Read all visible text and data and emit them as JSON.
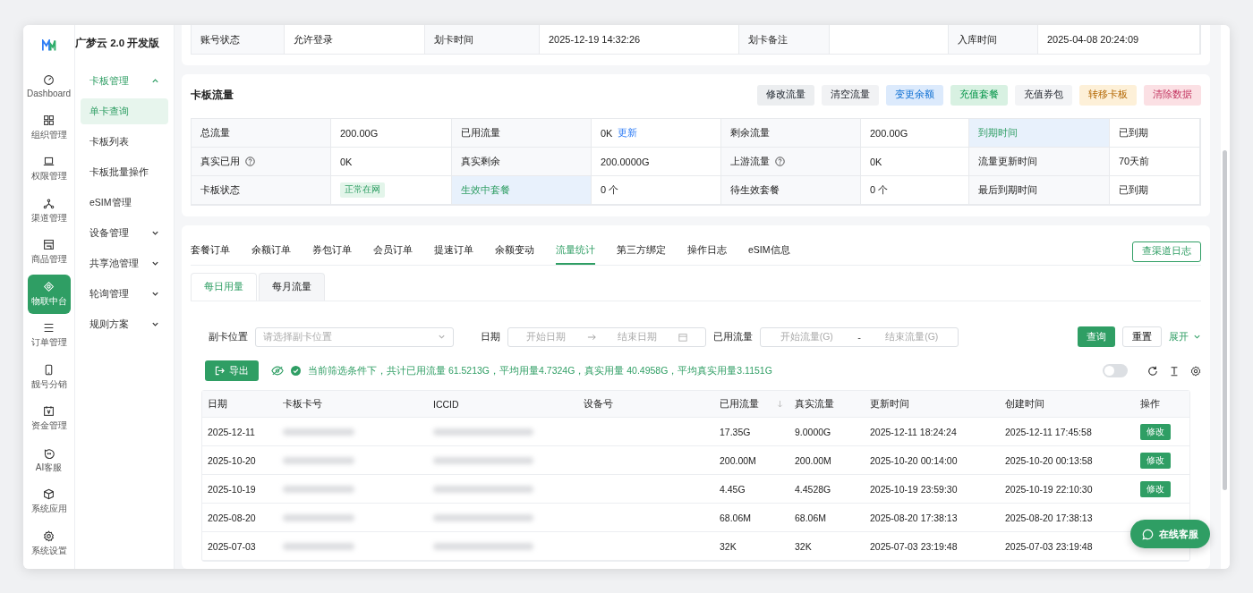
{
  "brand": {
    "title": "广梦云 2.0 开发版"
  },
  "nav_rail": [
    {
      "label": "Dashboard",
      "selected": false
    },
    {
      "label": "组织管理",
      "selected": false
    },
    {
      "label": "权限管理",
      "selected": false
    },
    {
      "label": "渠道管理",
      "selected": false
    },
    {
      "label": "商品管理",
      "selected": false
    },
    {
      "label": "物联中台",
      "selected": true
    },
    {
      "label": "订单管理",
      "selected": false
    },
    {
      "label": "靓号分销",
      "selected": false
    },
    {
      "label": "资金管理",
      "selected": false
    },
    {
      "label": "AI客服",
      "selected": false
    },
    {
      "label": "系统应用",
      "selected": false
    },
    {
      "label": "系统设置",
      "selected": false
    }
  ],
  "submenu": [
    {
      "label": "卡板管理",
      "expanded": true,
      "children": [
        {
          "label": "单卡查询",
          "selected": true
        },
        {
          "label": "卡板列表",
          "selected": false
        },
        {
          "label": "卡板批量操作",
          "selected": false
        },
        {
          "label": "eSIM管理",
          "selected": false
        }
      ]
    },
    {
      "label": "设备管理",
      "expanded": false
    },
    {
      "label": "共享池管理",
      "expanded": false
    },
    {
      "label": "轮询管理",
      "expanded": false
    },
    {
      "label": "规则方案",
      "expanded": false
    }
  ],
  "info_row": [
    {
      "label": "账号状态",
      "value": "允许登录"
    },
    {
      "label": "划卡时间",
      "value": "2025-12-19 14:32:26"
    },
    {
      "label": "划卡备注"
    },
    {
      "label": "入库时间",
      "value": "2025-04-08 20:24:09"
    }
  ],
  "flow_card": {
    "title": "卡板流量",
    "actions": [
      {
        "label": "修改流量",
        "color": "#eceef0"
      },
      {
        "label": "清空流量",
        "color": "#f1f2f4"
      },
      {
        "label": "变更余额",
        "color": "#dceafc"
      },
      {
        "label": "充值套餐",
        "color": "#d8f1e2"
      },
      {
        "label": "充值券包",
        "color": "#f3f4f6"
      },
      {
        "label": "转移卡板",
        "color": "#fdf0d8"
      },
      {
        "label": "清除数据",
        "color": "#fbe0e4"
      }
    ],
    "rows": [
      [
        {
          "text": "总流量",
          "kind": "label"
        },
        {
          "text": "200.00G",
          "kind": "value"
        },
        {
          "text": "已用流量",
          "kind": "label"
        },
        {
          "text": "0K",
          "kind": "value",
          "link": "更新"
        },
        {
          "text": "剩余流量",
          "kind": "label"
        },
        {
          "text": "200.00G",
          "kind": "value"
        },
        {
          "text": "到期时间",
          "kind": "label",
          "highlight": true
        },
        {
          "text": "已到期",
          "kind": "value"
        }
      ],
      [
        {
          "text": "真实已用",
          "kind": "label",
          "help": true
        },
        {
          "text": "0K",
          "kind": "value"
        },
        {
          "text": "真实剩余",
          "kind": "label"
        },
        {
          "text": "200.0000G",
          "kind": "value"
        },
        {
          "text": "上游流量",
          "kind": "label",
          "help": true
        },
        {
          "text": "0K",
          "kind": "value"
        },
        {
          "text": "流量更新时间",
          "kind": "label"
        },
        {
          "text": "70天前",
          "kind": "value"
        }
      ],
      [
        {
          "text": "卡板状态",
          "kind": "label"
        },
        {
          "text": "正常在网",
          "kind": "badge"
        },
        {
          "text": "生效中套餐",
          "kind": "label",
          "highlight": true
        },
        {
          "text": "0 个",
          "kind": "value"
        },
        {
          "text": "待生效套餐",
          "kind": "label"
        },
        {
          "text": "0 个",
          "kind": "value"
        },
        {
          "text": "最后到期时间",
          "kind": "label"
        },
        {
          "text": "已到期",
          "kind": "value"
        }
      ]
    ]
  },
  "tabs": [
    {
      "label": "套餐订单",
      "selected": false
    },
    {
      "label": "余额订单",
      "selected": false
    },
    {
      "label": "券包订单",
      "selected": false
    },
    {
      "label": "会员订单",
      "selected": false
    },
    {
      "label": "提速订单",
      "selected": false
    },
    {
      "label": "余额变动",
      "selected": false
    },
    {
      "label": "流量统计",
      "selected": true
    },
    {
      "label": "第三方绑定",
      "selected": false
    },
    {
      "label": "操作日志",
      "selected": false
    },
    {
      "label": "eSIM信息",
      "selected": false
    }
  ],
  "channel_log_button": "查渠道日志",
  "subtabs": [
    {
      "label": "每日用量",
      "selected": true
    },
    {
      "label": "每月流量",
      "selected": false
    }
  ],
  "filters": {
    "sub_card": {
      "label": "副卡位置",
      "placeholder": "请选择副卡位置"
    },
    "date": {
      "label": "日期",
      "start_placeholder": "开始日期",
      "end_placeholder": "结束日期"
    },
    "usage": {
      "label": "已用流量",
      "start_placeholder": "开始流量(G)",
      "separator": "-",
      "end_placeholder": "结束流量(G)"
    },
    "query": "查询",
    "reset": "重置",
    "expand": "展开"
  },
  "export_button": "导出",
  "summary": "当前筛选条件下，共计已用流量 61.5213G，平均用量4.7324G，真实用量 40.4958G，平均真实用量3.1151G",
  "column_toggle": {
    "on": false
  },
  "table": {
    "columns": [
      {
        "label": "日期",
        "sortable": false
      },
      {
        "label": "卡板卡号",
        "sortable": false
      },
      {
        "label": "ICCID",
        "sortable": false
      },
      {
        "label": "设备号",
        "sortable": false
      },
      {
        "label": "已用流量",
        "sortable": true
      },
      {
        "label": "真实流量",
        "sortable": false
      },
      {
        "label": "更新时间",
        "sortable": false
      },
      {
        "label": "创建时间",
        "sortable": false
      },
      {
        "label": "操作",
        "sortable": false
      }
    ],
    "rows": [
      {
        "date": "2025-12-11",
        "used": "17.35G",
        "real": "9.0000G",
        "updated": "2025-12-11 18:24:24",
        "created": "2025-12-11 17:45:58",
        "action": "修改"
      },
      {
        "date": "2025-10-20",
        "used": "200.00M",
        "real": "200.00M",
        "updated": "2025-10-20 00:14:00",
        "created": "2025-10-20 00:13:58",
        "action": "修改"
      },
      {
        "date": "2025-10-19",
        "used": "4.45G",
        "real": "4.4528G",
        "updated": "2025-10-19 23:59:30",
        "created": "2025-10-19 22:10:30",
        "action": "修改"
      },
      {
        "date": "2025-08-20",
        "used": "68.06M",
        "real": "68.06M",
        "updated": "2025-08-20 17:38:13",
        "created": "2025-08-20 17:38:13"
      },
      {
        "date": "2025-07-03",
        "used": "32K",
        "real": "32K",
        "updated": "2025-07-03 23:19:48",
        "created": "2025-07-03 23:19:48"
      }
    ]
  },
  "chat_button": "在线客服"
}
